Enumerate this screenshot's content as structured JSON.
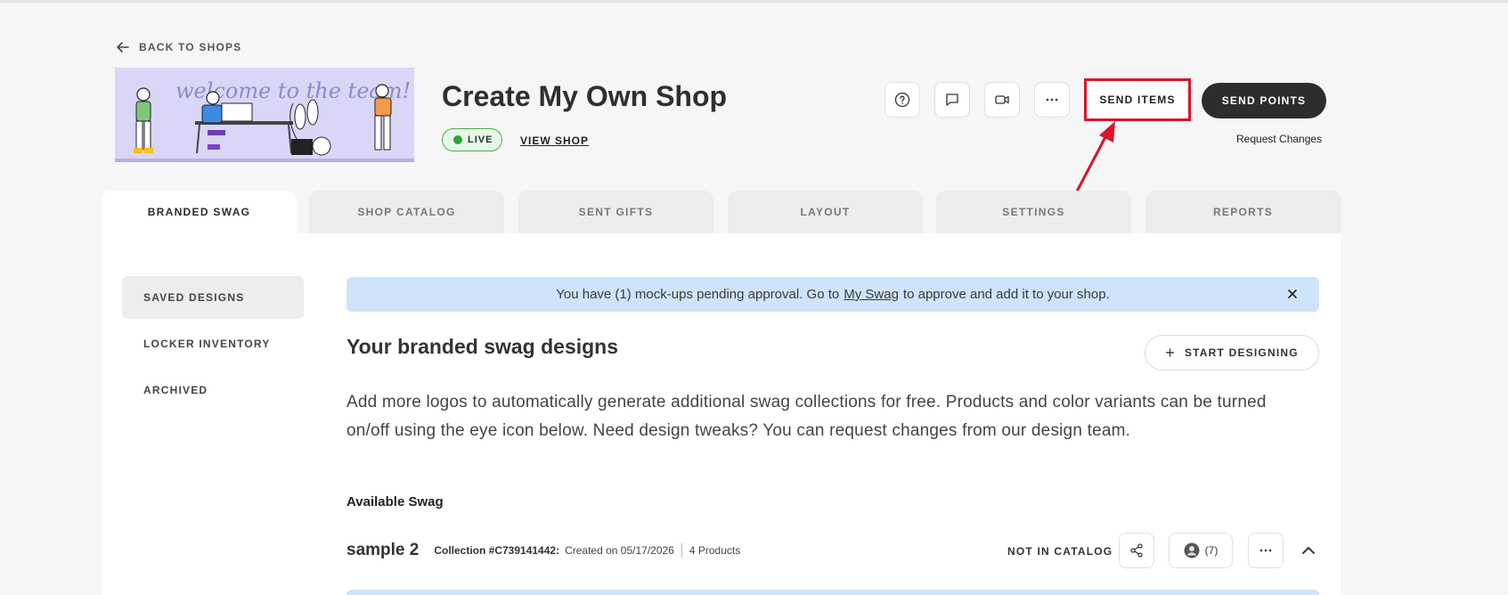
{
  "nav": {
    "back_label": "BACK TO SHOPS"
  },
  "banner": {
    "text": "welcome to the team!"
  },
  "shop": {
    "title": "Create My Own Shop",
    "status": "LIVE",
    "view_shop": "VIEW SHOP"
  },
  "toolbar": {
    "icons": [
      "help-circle-icon",
      "chat-icon",
      "video-icon",
      "more-horizontal-icon"
    ],
    "send_items": "SEND ITEMS",
    "send_points": "SEND POINTS",
    "request_changes": "Request Changes"
  },
  "tabs": [
    {
      "label": "BRANDED SWAG",
      "active": true
    },
    {
      "label": "SHOP CATALOG",
      "active": false
    },
    {
      "label": "SENT GIFTS",
      "active": false
    },
    {
      "label": "LAYOUT",
      "active": false
    },
    {
      "label": "SETTINGS",
      "active": false
    },
    {
      "label": "REPORTS",
      "active": false
    }
  ],
  "sidebar": {
    "items": [
      {
        "label": "SAVED DESIGNS",
        "active": true
      },
      {
        "label": "LOCKER INVENTORY",
        "active": false
      },
      {
        "label": "ARCHIVED",
        "active": false
      }
    ]
  },
  "alert": {
    "text_before": "You have (1) mock-ups pending approval. Go to",
    "link": "My Swag",
    "text_after": "to approve and add it to your shop."
  },
  "main": {
    "title": "Your branded swag designs",
    "start_designing": "START DESIGNING",
    "description": "Add more logos to automatically generate additional swag collections for free. Products and color variants can be turned on/off using the eye icon below. Need design tweaks? You can request changes from our design team.",
    "available_label": "Available Swag"
  },
  "collection": {
    "name": "sample 2",
    "id_label": "Collection #C739141442:",
    "created": "Created on 05/17/2026",
    "products": "4 Products",
    "catalog_status": "NOT IN CATALOG",
    "member_count": "(7)"
  },
  "colors": {
    "highlight": "#d9152a",
    "dark_button": "#2d2d2d",
    "alert_bg": "#cfe3fb",
    "live_green": "#2fa33a"
  }
}
